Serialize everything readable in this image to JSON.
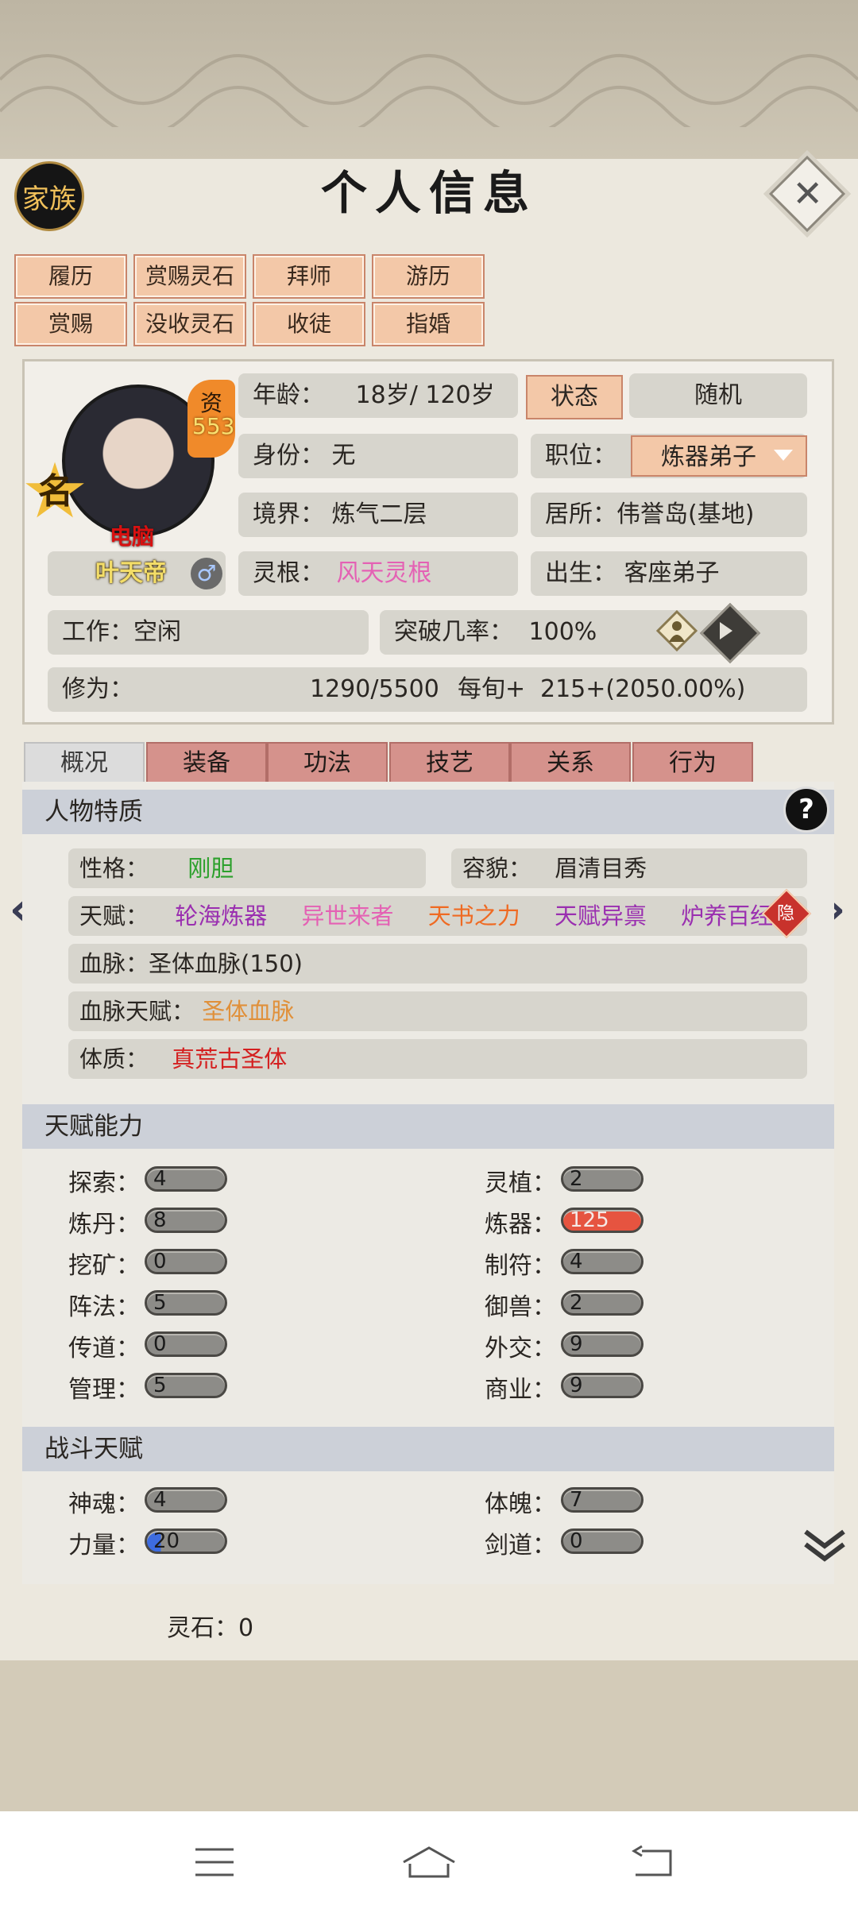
{
  "header": {
    "clan_label": "家族",
    "title": "个人信息"
  },
  "top_buttons": {
    "row1": [
      "履历",
      "赏赐灵石",
      "拜师",
      "游历"
    ],
    "row2": [
      "赏赐",
      "没收灵石",
      "收徒",
      "指婚"
    ]
  },
  "character": {
    "name": "叶天帝",
    "fame_badge": "名",
    "talent_label": "资",
    "talent_value": "553",
    "controller": "电脑",
    "age_label": "年龄：",
    "age_value": "18岁/ 120岁",
    "state_button": "状态",
    "random_button": "随机",
    "identity": "身份：  无",
    "position_label": "职位：",
    "position_value": "炼器弟子",
    "realm": "境界：  炼气二层",
    "residence": "居所：伟誉岛(基地)",
    "root_label": "灵根：",
    "root_value": "风天灵根",
    "birth": "出生：  客座弟子",
    "work": "工作：空闲",
    "breakthrough_label": "突破几率：",
    "breakthrough_value": "100%",
    "cultivation_label": "修为：",
    "cultivation_value": "1290/5500",
    "per_period_label": "每旬+",
    "per_period_value": "215+(2050.00%)"
  },
  "tabs": [
    "概况",
    "装备",
    "功法",
    "技艺",
    "关系",
    "行为"
  ],
  "traits": {
    "section_title": "人物特质",
    "help": "?",
    "personality_label": "性格：",
    "personality_value": "刚胆",
    "appearance_label": "容貌：",
    "appearance_value": "眉清目秀",
    "talents_label": "天赋：",
    "talents": [
      {
        "name": "轮海炼器",
        "color": "#9a2fb0"
      },
      {
        "name": "异世来者",
        "color": "#e461b4"
      },
      {
        "name": "天书之力",
        "color": "#ef6a22"
      },
      {
        "name": "天赋异禀",
        "color": "#9a2fb0"
      },
      {
        "name": "炉养百经",
        "color": "#9a2fb0"
      }
    ],
    "hidden_badge": "隐",
    "bloodline": "血脉：圣体血脉(150)",
    "bloodline_talent_label": "血脉天赋：",
    "bloodline_talent_value": "圣体血脉",
    "physique_label": "体质：",
    "physique_value": "真荒古圣体"
  },
  "abilities": {
    "section_title": "天赋能力",
    "left": [
      {
        "label": "探索：",
        "value": "4"
      },
      {
        "label": "炼丹：",
        "value": "8"
      },
      {
        "label": "挖矿：",
        "value": "0"
      },
      {
        "label": "阵法：",
        "value": "5"
      },
      {
        "label": "传道：",
        "value": "0"
      },
      {
        "label": "管理：",
        "value": "5"
      }
    ],
    "right": [
      {
        "label": "灵植：",
        "value": "2"
      },
      {
        "label": "炼器：",
        "value": "125"
      },
      {
        "label": "制符：",
        "value": "4"
      },
      {
        "label": "御兽：",
        "value": "2"
      },
      {
        "label": "外交：",
        "value": "9"
      },
      {
        "label": "商业：",
        "value": "9"
      }
    ]
  },
  "combat": {
    "section_title": "战斗天赋",
    "left": [
      {
        "label": "神魂：",
        "value": "4"
      },
      {
        "label": "力量：",
        "value": "20"
      }
    ],
    "right": [
      {
        "label": "体魄：",
        "value": "7"
      },
      {
        "label": "剑道：",
        "value": "0"
      }
    ]
  },
  "footer": {
    "spirit_stones": "灵石：0"
  },
  "colors": {
    "accent_button": "#f3c8a8",
    "tab": "#d5928c",
    "root_color": "#e461b4",
    "personality_color": "#2ca02c",
    "bloodline_talent_color": "#e0903a",
    "physique_color": "#d42020"
  },
  "icons": [
    "close-icon",
    "gender-male-icon",
    "breakthrough-icon",
    "play-icon",
    "help-icon",
    "left-arrow-icon",
    "right-arrow-icon",
    "chevron-down-icon",
    "menu-icon",
    "home-icon",
    "back-icon"
  ]
}
